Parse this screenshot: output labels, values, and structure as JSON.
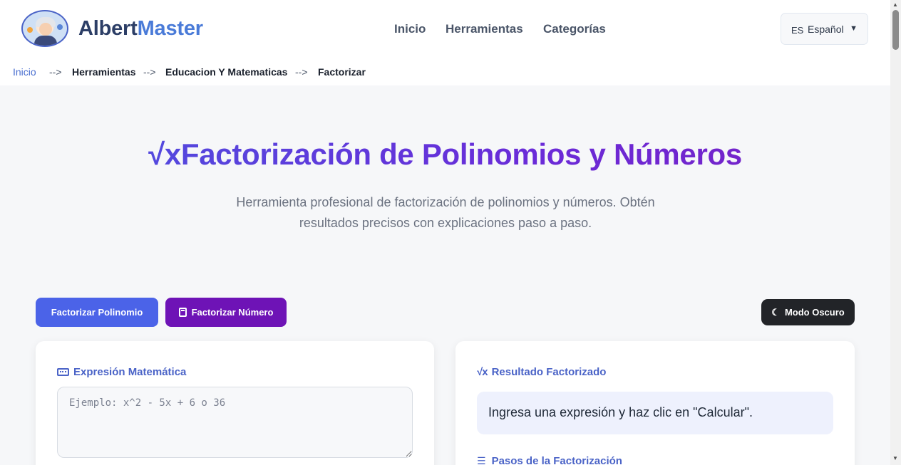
{
  "header": {
    "brand_part1": "Albert",
    "brand_part2": "Master",
    "nav": [
      "Inicio",
      "Herramientas",
      "Categorías"
    ],
    "language": {
      "code": "ES",
      "name": "Español",
      "caret": "▼"
    }
  },
  "breadcrumb": {
    "items": [
      "Inicio",
      "Herramientas",
      "Educacion Y Matematicas",
      "Factorizar"
    ],
    "separator": "-->"
  },
  "hero": {
    "title": "√xFactorización de Polinomios y Números",
    "subtitle": "Herramienta profesional de factorización de polinomios y números. Obtén resultados precisos con explicaciones paso a paso."
  },
  "buttons": {
    "factor_polynomial": "Factorizar Polinomio",
    "factor_number": "Factorizar Número",
    "dark_mode": "Modo Oscuro"
  },
  "input_card": {
    "title": "Expresión Matemática",
    "placeholder": "Ejemplo: x^2 - 5x + 6 o 36"
  },
  "result_card": {
    "title": "Resultado Factorizado",
    "message": "Ingresa una expresión y haz clic en \"Calcular\".",
    "steps_title": "Pasos de la Factorización"
  }
}
